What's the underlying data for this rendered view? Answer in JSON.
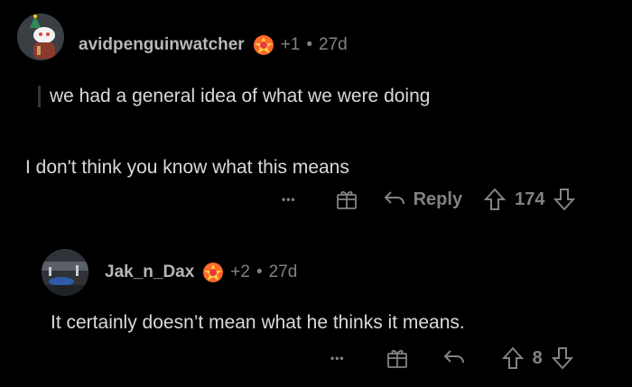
{
  "comments": [
    {
      "username": "avidpenguinwatcher",
      "karma": "+1",
      "separator": "•",
      "age": "27d",
      "quote": "we had a general idea of what we were doing",
      "text": "I don't think you know what this means",
      "actions": {
        "more": "•••",
        "reply_label": "Reply",
        "votes": "174"
      }
    },
    {
      "username": "Jak_n_Dax",
      "karma": "+2",
      "separator": "•",
      "age": "27d",
      "text": "It certainly doesn’t mean what he thinks it means.",
      "actions": {
        "more": "•••",
        "votes": "8"
      }
    }
  ],
  "colors": {
    "background": "#000000",
    "text": "#d7dadc",
    "muted": "#818384"
  }
}
